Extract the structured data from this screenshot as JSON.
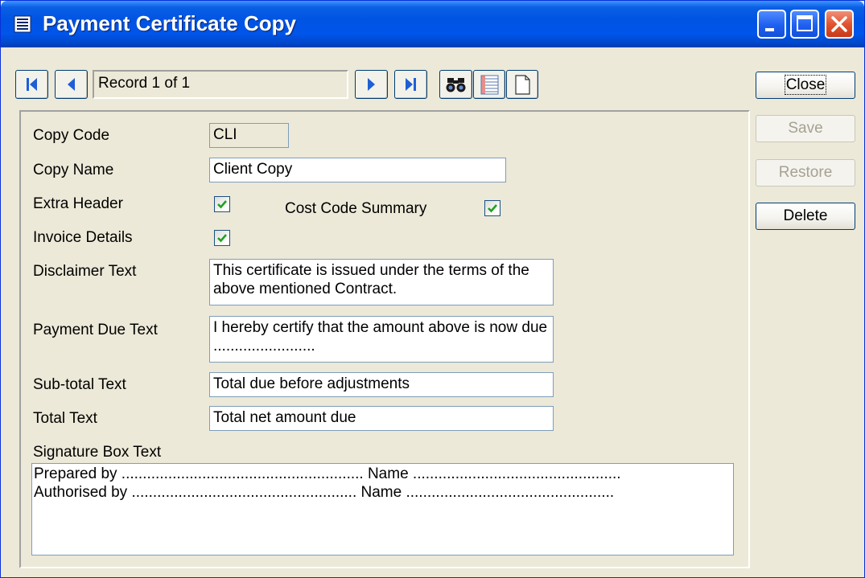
{
  "window": {
    "title": "Payment Certificate Copy"
  },
  "navigation": {
    "record_text": "Record 1 of 1"
  },
  "actions": {
    "close_label": "Close",
    "save_label": "Save",
    "restore_label": "Restore",
    "delete_label": "Delete"
  },
  "form": {
    "copy_code": {
      "label": "Copy Code",
      "value": "CLI"
    },
    "copy_name": {
      "label": "Copy Name",
      "value": "Client Copy"
    },
    "extra_header": {
      "label": "Extra Header",
      "checked": true
    },
    "cost_code_summary": {
      "label": "Cost Code Summary",
      "checked": true
    },
    "invoice_details": {
      "label": "Invoice Details",
      "checked": true
    },
    "disclaimer_text": {
      "label": "Disclaimer Text",
      "value": "This certificate is issued under the terms of the above mentioned Contract."
    },
    "payment_due_text": {
      "label": "Payment Due Text",
      "value": "I hereby certify that the amount above is now due ........................"
    },
    "subtotal_text": {
      "label": "Sub-total Text",
      "value": "Total due before adjustments"
    },
    "total_text": {
      "label": "Total Text",
      "value": "Total net amount due"
    },
    "signature_box_text": {
      "label": "Signature Box Text",
      "lines": [
        "Prepared by ......................................................... Name .................................................",
        "Authorised by ..................................................... Name ................................................."
      ]
    }
  },
  "colors": {
    "titlebar": "#0054e3",
    "window_bg": "#ece9d8",
    "check_green": "#21a121",
    "nav_icon_blue": "#1f5fd6"
  },
  "icons": {
    "first_record": "first-record-icon",
    "previous_record": "previous-record-icon",
    "next_record": "next-record-icon",
    "last_record": "last-record-icon",
    "find": "binoculars-icon",
    "list_view": "list-view-icon",
    "new_record": "new-document-icon"
  }
}
